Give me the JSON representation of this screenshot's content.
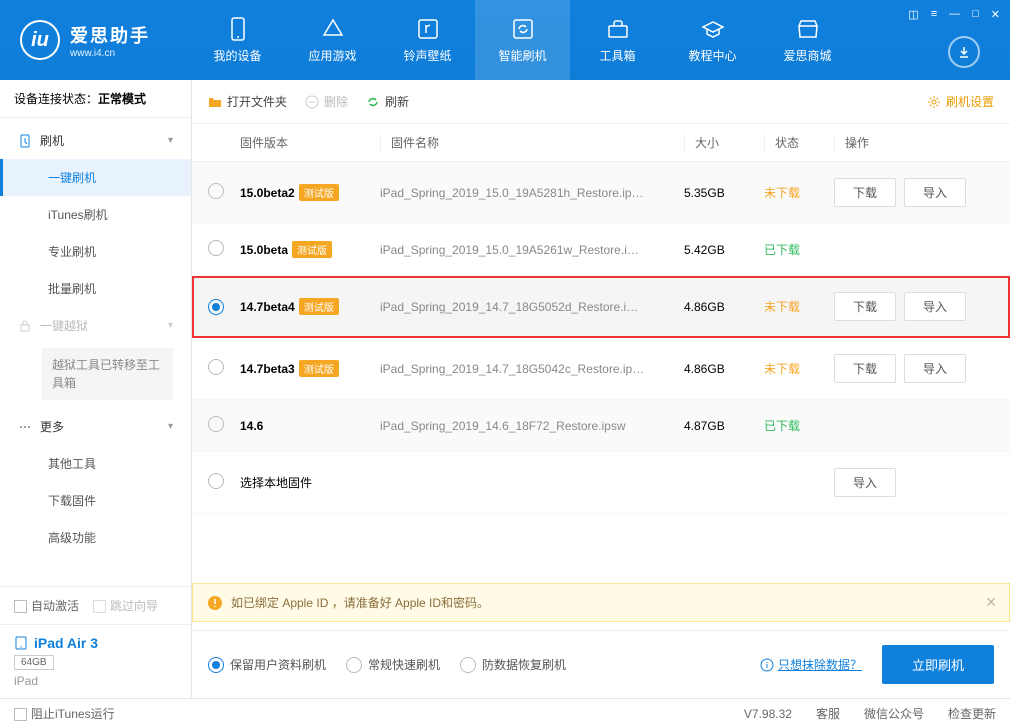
{
  "logo": {
    "title": "爱思助手",
    "url": "www.i4.cn"
  },
  "nav": [
    {
      "label": "我的设备"
    },
    {
      "label": "应用游戏"
    },
    {
      "label": "铃声壁纸"
    },
    {
      "label": "智能刷机"
    },
    {
      "label": "工具箱"
    },
    {
      "label": "教程中心"
    },
    {
      "label": "爱思商城"
    }
  ],
  "sidebar": {
    "status_label": "设备连接状态：",
    "status_value": "正常模式",
    "flash_section": "刷机",
    "items": {
      "oneclick": "一键刷机",
      "itunes": "iTunes刷机",
      "pro": "专业刷机",
      "batch": "批量刷机",
      "jailbreak": "一键越狱",
      "jbnote": "越狱工具已转移至工具箱",
      "more": "更多",
      "other": "其他工具",
      "download": "下载固件",
      "advanced": "高级功能"
    },
    "auto_activate": "自动激活",
    "skip_guide": "跳过向导",
    "device_name": "iPad Air 3",
    "device_storage": "64GB",
    "device_type": "iPad"
  },
  "toolbar": {
    "open": "打开文件夹",
    "delete": "删除",
    "refresh": "刷新",
    "settings": "刷机设置"
  },
  "columns": {
    "version": "固件版本",
    "name": "固件名称",
    "size": "大小",
    "status": "状态",
    "action": "操作"
  },
  "beta_tag": "测试版",
  "rows": [
    {
      "version": "15.0beta2",
      "beta": true,
      "name": "iPad_Spring_2019_15.0_19A5281h_Restore.ip…",
      "size": "5.35GB",
      "status": "未下载",
      "status_class": "not",
      "download": true,
      "import": true,
      "selected": false
    },
    {
      "version": "15.0beta",
      "beta": true,
      "name": "iPad_Spring_2019_15.0_19A5261w_Restore.i…",
      "size": "5.42GB",
      "status": "已下载",
      "status_class": "done",
      "download": false,
      "import": false,
      "selected": false
    },
    {
      "version": "14.7beta4",
      "beta": true,
      "name": "iPad_Spring_2019_14.7_18G5052d_Restore.i…",
      "size": "4.86GB",
      "status": "未下载",
      "status_class": "not",
      "download": true,
      "import": true,
      "selected": true,
      "highlighted": true
    },
    {
      "version": "14.7beta3",
      "beta": true,
      "name": "iPad_Spring_2019_14.7_18G5042c_Restore.ip…",
      "size": "4.86GB",
      "status": "未下载",
      "status_class": "not",
      "download": true,
      "import": true,
      "selected": false
    },
    {
      "version": "14.6",
      "beta": false,
      "name": "iPad_Spring_2019_14.6_18F72_Restore.ipsw",
      "size": "4.87GB",
      "status": "已下载",
      "status_class": "done",
      "download": false,
      "import": false,
      "selected": false
    }
  ],
  "local_row": {
    "label": "选择本地固件",
    "import_btn": "导入"
  },
  "buttons": {
    "download": "下载",
    "import": "导入"
  },
  "notice": "如已绑定 Apple ID ，请准备好 Apple ID和密码。",
  "flash_options": {
    "keep": "保留用户资料刷机",
    "normal": "常规快速刷机",
    "antirecovery": "防数据恢复刷机",
    "erase_link": "只想抹除数据？",
    "flash_btn": "立即刷机"
  },
  "footer": {
    "block_itunes": "阻止iTunes运行",
    "version": "V7.98.32",
    "service": "客服",
    "wechat": "微信公众号",
    "update": "检查更新"
  }
}
